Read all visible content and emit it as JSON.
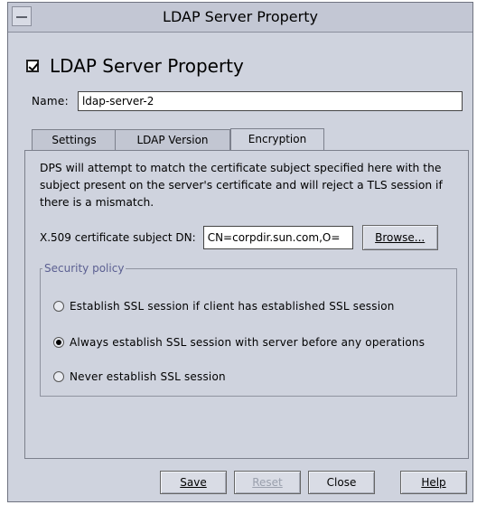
{
  "window": {
    "title": "LDAP Server Property"
  },
  "header": {
    "enabled": true,
    "title": "LDAP Server Property"
  },
  "name_field": {
    "label": "Name:",
    "value": "ldap-server-2"
  },
  "tabs": [
    {
      "label": "Settings",
      "active": false
    },
    {
      "label": "LDAP Version",
      "active": false
    },
    {
      "label": "Encryption",
      "active": true
    }
  ],
  "encryption": {
    "description": "DPS will attempt to match the certificate subject specified here with the subject present on the server's certificate and will reject a TLS session if there is a mismatch.",
    "cert_label": "X.509 certificate subject DN:",
    "cert_value": "CN=corpdir.sun.com,O=",
    "browse_label": "Browse...",
    "security_policy": {
      "legend": "Security policy",
      "options": [
        {
          "label": "Establish SSL session if client has established SSL session",
          "selected": false
        },
        {
          "label": "Always establish SSL session with server before any operations",
          "selected": true
        },
        {
          "label": "Never establish SSL session",
          "selected": false
        }
      ]
    }
  },
  "buttons": {
    "save": "Save",
    "reset": "Reset",
    "close": "Close",
    "help": "Help"
  },
  "colors": {
    "window_bg": "#cfd3de",
    "legend_text": "#5b5f91",
    "disabled_text": "#9aa0ad"
  }
}
